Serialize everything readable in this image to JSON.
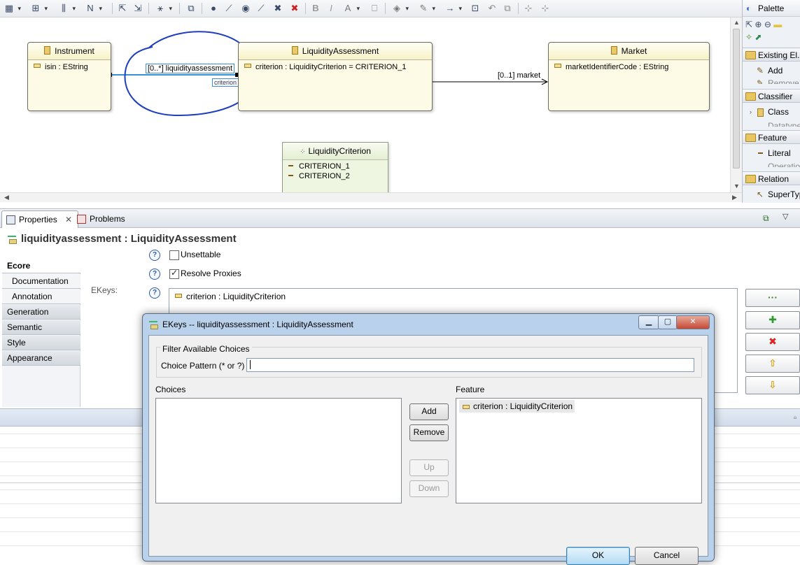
{
  "palette": {
    "title": "Palette",
    "drawers": [
      {
        "label": "Existing El...",
        "items": [
          "Add",
          "Remove"
        ]
      },
      {
        "label": "Classifier",
        "items": [
          "Class",
          "Datatype"
        ]
      },
      {
        "label": "Feature",
        "items": [
          "Literal",
          "Operation"
        ]
      },
      {
        "label": "Relation",
        "items": [
          "SuperTyp"
        ]
      }
    ]
  },
  "diagram": {
    "instrument": {
      "name": "Instrument",
      "attr": "isin : EString"
    },
    "liquidity_assessment": {
      "name": "LiquidityAssessment",
      "attr": "criterion : LiquidityCriterion = CRITERION_1"
    },
    "market": {
      "name": "Market",
      "attr": "marketIdentifierCode : EString"
    },
    "liquidity_criterion": {
      "name": "LiquidityCriterion",
      "literals": [
        "CRITERION_1",
        "CRITERION_2"
      ]
    },
    "edge_label_assessment": "[0..*] liquidityassessment",
    "edge_label_key": "criterion",
    "edge_label_market": "[0..1] market"
  },
  "views": {
    "properties_tab": "Properties",
    "problems_tab": "Problems"
  },
  "properties": {
    "title": "liquidityassessment : LiquidityAssessment",
    "sections": [
      "Ecore",
      "Documentation",
      "Annotation",
      "Generation",
      "Semantic",
      "Style",
      "Appearance"
    ],
    "unsettable_label": "Unsettable",
    "resolve_proxies_label": "Resolve Proxies",
    "ekeys_label": "EKeys:",
    "ekeys_value": "criterion : LiquidityCriterion",
    "help_glyph": "?",
    "buttons": {
      "browse": "···",
      "add": "✚",
      "remove": "✖",
      "up": "⇧",
      "down": "⇩"
    }
  },
  "dialog": {
    "title": "EKeys -- liquidityassessment : LiquidityAssessment",
    "filter_group": "Filter Available Choices",
    "pattern_label": "Choice Pattern (* or ?)",
    "pattern_value": "",
    "choices_label": "Choices",
    "feature_label": "Feature",
    "feature_items": [
      "criterion : LiquidityCriterion"
    ],
    "add": "Add",
    "remove": "Remove",
    "up": "Up",
    "down": "Down",
    "ok": "OK",
    "cancel": "Cancel",
    "min_glyph": "▁",
    "max_glyph": "▢",
    "close_glyph": "✕"
  },
  "colors": {
    "class_fill": "#fdfbe6",
    "enum_fill": "#eef5e0",
    "selection_blue": "#3b8fd8",
    "annotation_circle": "#1f3fbf",
    "dialog_frame": "#b9d1ea"
  }
}
